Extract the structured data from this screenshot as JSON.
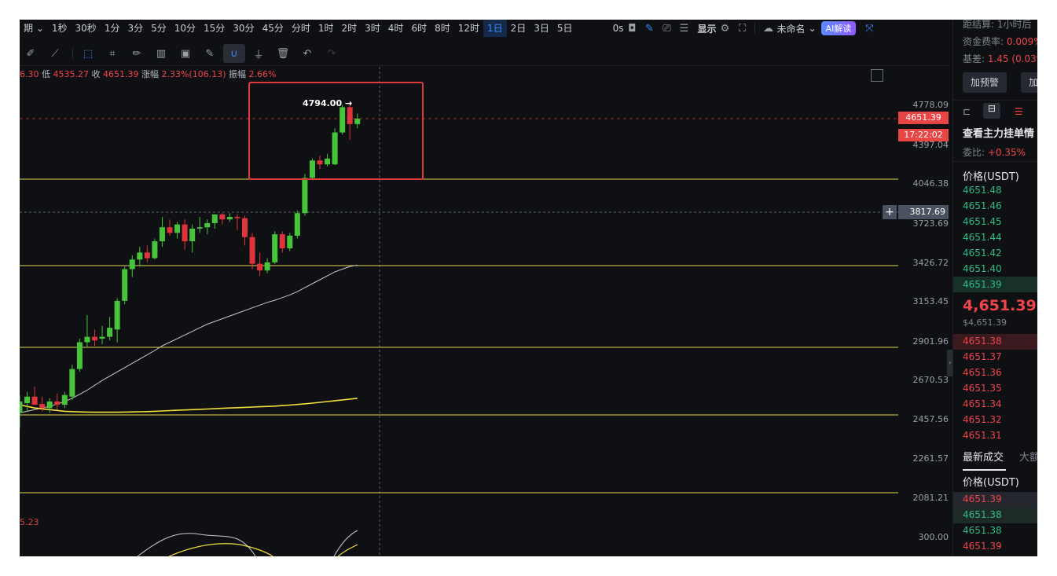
{
  "toolbar": {
    "prefix": "期",
    "timeframes": [
      "1秒",
      "30秒",
      "1分",
      "3分",
      "5分",
      "10分",
      "15分",
      "30分",
      "45分",
      "分时",
      "1时",
      "2时",
      "3时",
      "4时",
      "6时",
      "8时",
      "12时",
      "1日",
      "2日",
      "3日",
      "5日"
    ],
    "active_timeframe": "1日",
    "countdown_label": "0s",
    "display_label": "显示",
    "layout_name": "未命名",
    "ai_label": "AI解读"
  },
  "ohlc_info": {
    "high_partial": "6.30",
    "low_label": "低",
    "low": "4535.27",
    "close_label": "收",
    "close": "4651.39",
    "change_label": "涨幅",
    "change": "2.33%(106.13)",
    "amplitude_label": "振幅",
    "amplitude": "2.66%"
  },
  "annotation": {
    "peak_label": "4794.00"
  },
  "current_price_label": "4651.39",
  "countdown_time": "17:22:02",
  "crosshair_price": "3817.69",
  "osc_value_partial": "5.23",
  "axis_ticks": [
    "4778.09",
    "4397.04",
    "4046.38",
    "3723.69",
    "3426.72",
    "3153.45",
    "2901.96",
    "2670.53",
    "2457.56",
    "2261.57",
    "2081.21",
    "300.00"
  ],
  "colors": {
    "up": "#46c43a",
    "down": "#e0343c",
    "hline": "#e6d84a",
    "highlight_box": "#e23b3b",
    "ma_white": "#c9c9c9",
    "ma_yellow": "#f2e03a"
  },
  "chart_data": {
    "type": "candlestick",
    "title": "",
    "interval": "1日",
    "ylim": [
      2000,
      4900
    ],
    "horizontal_levels": [
      4046.38,
      3426.72,
      2901.96,
      2457.56,
      2081.21
    ],
    "current_price": 4651.39,
    "peak": 4794.0,
    "candles": [
      {
        "o": 2470,
        "h": 2580,
        "l": 2400,
        "c": 2540
      },
      {
        "o": 2530,
        "h": 2600,
        "l": 2480,
        "c": 2570
      },
      {
        "o": 2570,
        "h": 2630,
        "l": 2520,
        "c": 2520
      },
      {
        "o": 2525,
        "h": 2570,
        "l": 2480,
        "c": 2500
      },
      {
        "o": 2500,
        "h": 2560,
        "l": 2470,
        "c": 2540
      },
      {
        "o": 2540,
        "h": 2590,
        "l": 2490,
        "c": 2520
      },
      {
        "o": 2520,
        "h": 2600,
        "l": 2500,
        "c": 2580
      },
      {
        "o": 2570,
        "h": 2780,
        "l": 2550,
        "c": 2750
      },
      {
        "o": 2750,
        "h": 2950,
        "l": 2730,
        "c": 2930
      },
      {
        "o": 2930,
        "h": 3080,
        "l": 2900,
        "c": 2960
      },
      {
        "o": 2960,
        "h": 3000,
        "l": 2910,
        "c": 2940
      },
      {
        "o": 2950,
        "h": 3020,
        "l": 2920,
        "c": 2960
      },
      {
        "o": 2960,
        "h": 3070,
        "l": 2940,
        "c": 3010
      },
      {
        "o": 3000,
        "h": 3180,
        "l": 2930,
        "c": 3160
      },
      {
        "o": 3160,
        "h": 3420,
        "l": 3140,
        "c": 3400
      },
      {
        "o": 3400,
        "h": 3500,
        "l": 3340,
        "c": 3470
      },
      {
        "o": 3470,
        "h": 3560,
        "l": 3420,
        "c": 3520
      },
      {
        "o": 3520,
        "h": 3570,
        "l": 3450,
        "c": 3480
      },
      {
        "o": 3480,
        "h": 3620,
        "l": 3470,
        "c": 3600
      },
      {
        "o": 3600,
        "h": 3780,
        "l": 3560,
        "c": 3700
      },
      {
        "o": 3700,
        "h": 3760,
        "l": 3640,
        "c": 3660
      },
      {
        "o": 3660,
        "h": 3740,
        "l": 3620,
        "c": 3720
      },
      {
        "o": 3720,
        "h": 3760,
        "l": 3540,
        "c": 3600
      },
      {
        "o": 3600,
        "h": 3720,
        "l": 3520,
        "c": 3690
      },
      {
        "o": 3690,
        "h": 3780,
        "l": 3660,
        "c": 3700
      },
      {
        "o": 3700,
        "h": 3760,
        "l": 3650,
        "c": 3730
      },
      {
        "o": 3730,
        "h": 3800,
        "l": 3690,
        "c": 3800
      },
      {
        "o": 3800,
        "h": 3810,
        "l": 3720,
        "c": 3760
      },
      {
        "o": 3760,
        "h": 3810,
        "l": 3740,
        "c": 3780
      },
      {
        "o": 3780,
        "h": 3800,
        "l": 3680,
        "c": 3770
      },
      {
        "o": 3770,
        "h": 3790,
        "l": 3570,
        "c": 3630
      },
      {
        "o": 3630,
        "h": 3660,
        "l": 3400,
        "c": 3440
      },
      {
        "o": 3440,
        "h": 3520,
        "l": 3350,
        "c": 3390
      },
      {
        "o": 3390,
        "h": 3480,
        "l": 3370,
        "c": 3450
      },
      {
        "o": 3450,
        "h": 3670,
        "l": 3440,
        "c": 3650
      },
      {
        "o": 3650,
        "h": 3670,
        "l": 3520,
        "c": 3550
      },
      {
        "o": 3550,
        "h": 3660,
        "l": 3530,
        "c": 3640
      },
      {
        "o": 3640,
        "h": 3830,
        "l": 3620,
        "c": 3810
      },
      {
        "o": 3810,
        "h": 4100,
        "l": 3790,
        "c": 4060
      },
      {
        "o": 4060,
        "h": 4260,
        "l": 4040,
        "c": 4240
      },
      {
        "o": 4240,
        "h": 4290,
        "l": 4150,
        "c": 4200
      },
      {
        "o": 4200,
        "h": 4310,
        "l": 4180,
        "c": 4260
      },
      {
        "o": 4200,
        "h": 4560,
        "l": 4190,
        "c": 4520
      },
      {
        "o": 4520,
        "h": 4780,
        "l": 4500,
        "c": 4760
      },
      {
        "o": 4760,
        "h": 4794,
        "l": 4450,
        "c": 4600
      },
      {
        "o": 4600,
        "h": 4700,
        "l": 4560,
        "c": 4651.39
      }
    ],
    "ma_white": [
      2470,
      2480,
      2490,
      2500,
      2510,
      2525,
      2540,
      2560,
      2585,
      2610,
      2640,
      2670,
      2700,
      2730,
      2760,
      2790,
      2820,
      2850,
      2880,
      2910,
      2930,
      2950,
      2970,
      2990,
      3010,
      3030,
      3045,
      3060,
      3075,
      3090,
      3105,
      3120,
      3135,
      3150,
      3165,
      3185,
      3205,
      3230,
      3260,
      3290,
      3320,
      3350,
      3380,
      3400,
      3420,
      3430
    ],
    "ma_yellow": [
      2520,
      2510,
      2500,
      2495,
      2490,
      2485,
      2480,
      2478,
      2476,
      2475,
      2474,
      2474,
      2474,
      2474,
      2475,
      2476,
      2477,
      2478,
      2480,
      2482,
      2484,
      2486,
      2488,
      2490,
      2492,
      2494,
      2496,
      2498,
      2500,
      2502,
      2504,
      2506,
      2508,
      2510,
      2512,
      2515,
      2518,
      2522,
      2526,
      2530,
      2535,
      2540,
      2545,
      2550,
      2555,
      2560
    ]
  },
  "orderbook": {
    "settlement_label": "距结算: 1小时后",
    "funding_label": "资金费率:",
    "funding_value": "0.009%",
    "basis_label": "基差:",
    "basis_value": "1.45 (0.03%)",
    "alert_btn": "加预警",
    "alert_btn2": "加",
    "depth_link": "查看主力挂单情",
    "ratio_label": "委比:",
    "ratio_value": "+0.35%",
    "price_header": "价格(USDT)",
    "bids": [
      "4651.48",
      "4651.46",
      "4651.45",
      "4651.44",
      "4651.42",
      "4651.40",
      "4651.39"
    ],
    "last_price": "4,651.39",
    "last_price_usd": "$4,651.39",
    "asks": [
      "4651.38",
      "4651.37",
      "4651.36",
      "4651.35",
      "4651.34",
      "4651.32",
      "4651.31"
    ],
    "trades_tab": "最新成交",
    "trades_tab2": "大额",
    "trades_header": "价格(USDT)",
    "trades": [
      {
        "price": "4651.39",
        "side": "sell"
      },
      {
        "price": "4651.38",
        "side": "buy"
      },
      {
        "price": "4651.38",
        "side": "buy"
      },
      {
        "price": "4651.39",
        "side": "sell"
      }
    ]
  }
}
